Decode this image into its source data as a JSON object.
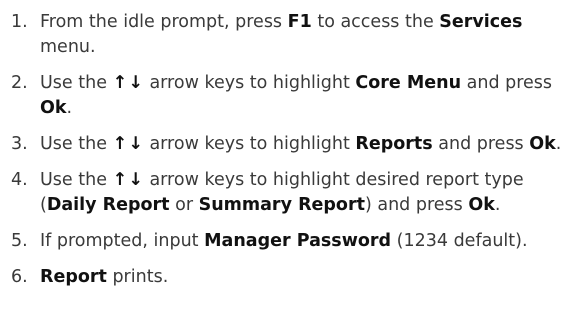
{
  "steps": [
    {
      "number": "1.",
      "parts": [
        {
          "text": "From the idle prompt, press "
        },
        {
          "text": "F1",
          "bold": true
        },
        {
          "text": " to access the "
        },
        {
          "text": "Services",
          "bold": true
        },
        {
          "text": " menu."
        }
      ]
    },
    {
      "number": "2.",
      "parts": [
        {
          "text": "Use the "
        },
        {
          "text": "↑↓",
          "arrows": true
        },
        {
          "text": " arrow keys to highlight "
        },
        {
          "text": "Core Menu",
          "bold": true
        },
        {
          "text": " and press "
        },
        {
          "text": "Ok",
          "bold": true
        },
        {
          "text": "."
        }
      ]
    },
    {
      "number": "3.",
      "parts": [
        {
          "text": "Use the "
        },
        {
          "text": "↑↓",
          "arrows": true
        },
        {
          "text": " arrow keys to highlight "
        },
        {
          "text": "Reports",
          "bold": true
        },
        {
          "text": " and press "
        },
        {
          "text": "Ok",
          "bold": true
        },
        {
          "text": "."
        }
      ]
    },
    {
      "number": "4.",
      "parts": [
        {
          "text": "Use the "
        },
        {
          "text": "↑↓",
          "arrows": true
        },
        {
          "text": " arrow keys to highlight desired report type ("
        },
        {
          "text": "Daily Report",
          "bold": true
        },
        {
          "text": " or "
        },
        {
          "text": "Summary Report",
          "bold": true
        },
        {
          "text": ") and press "
        },
        {
          "text": "Ok",
          "bold": true
        },
        {
          "text": "."
        }
      ]
    },
    {
      "number": "5.",
      "parts": [
        {
          "text": "If prompted, input "
        },
        {
          "text": "Manager Password",
          "bold": true
        },
        {
          "text": " (1234 default)."
        }
      ]
    },
    {
      "number": "6.",
      "parts": [
        {
          "text": "Report",
          "bold": true
        },
        {
          "text": " prints."
        }
      ]
    }
  ]
}
